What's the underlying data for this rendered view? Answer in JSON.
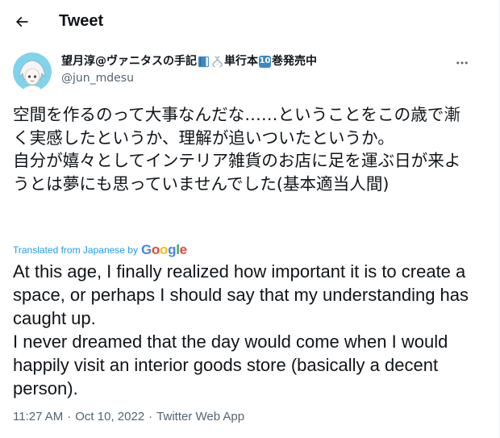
{
  "header": {
    "back_icon": "arrow-left-icon",
    "title": "Tweet"
  },
  "tweet": {
    "author": {
      "name_part1": "望月淳@ヴァニタスの手記",
      "name_part2": "単行本",
      "name_badge": "10",
      "name_part3": "巻発売中",
      "handle": "@jun_mdesu",
      "avatar_icon": "anime-character-avatar"
    },
    "more_icon": "more-dots-icon",
    "original_text": "空間を作るのって大事なんだな……ということをこの歳で漸く実感したというか、理解が追いついたというか。\n自分が嬉々としてインテリア雑貨のお店に足を運ぶ日が来ようとは夢にも思っていませんでした(基本適当人間)",
    "translated_label": "Translated from Japanese by",
    "translator": "Google",
    "translated_text": "At this age, I finally realized how important it is to create a space, or perhaps I should say that my understanding has caught up.\nI never dreamed that the day would come when I would happily visit an interior goods store (basically a decent person).",
    "time": "11:27 AM",
    "date": "Oct 10, 2022",
    "source": "Twitter Web App",
    "separator": "·"
  },
  "colors": {
    "accent": "#1d9bf0",
    "secondary_text": "#536471",
    "text": "#0f1419"
  }
}
